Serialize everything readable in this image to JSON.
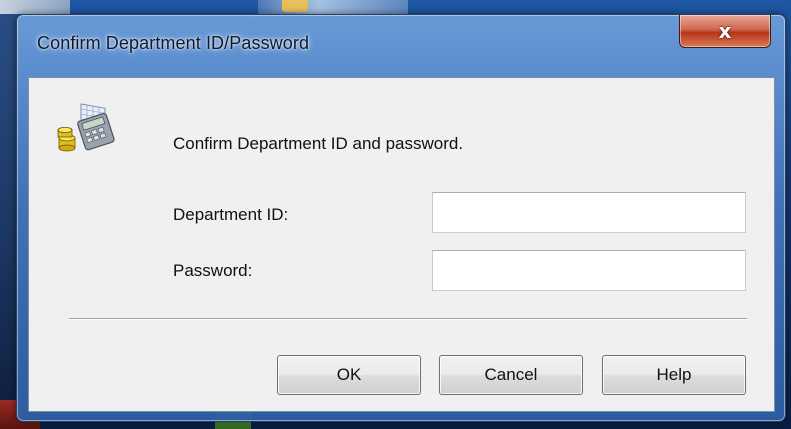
{
  "window": {
    "title": "Confirm Department ID/Password",
    "close_glyph": "x"
  },
  "dialog": {
    "icon": "department-id-calculator-icon",
    "message": "Confirm Department ID and password.",
    "fields": {
      "department_id": {
        "label": "Department ID:",
        "value": "",
        "placeholder": ""
      },
      "password": {
        "label": "Password:",
        "value": "",
        "placeholder": ""
      }
    },
    "buttons": {
      "ok": "OK",
      "cancel": "Cancel",
      "help": "Help"
    }
  },
  "colors": {
    "frame": "#4678be",
    "client_bg": "#f0f0f0",
    "close_button": "#c8432a"
  }
}
